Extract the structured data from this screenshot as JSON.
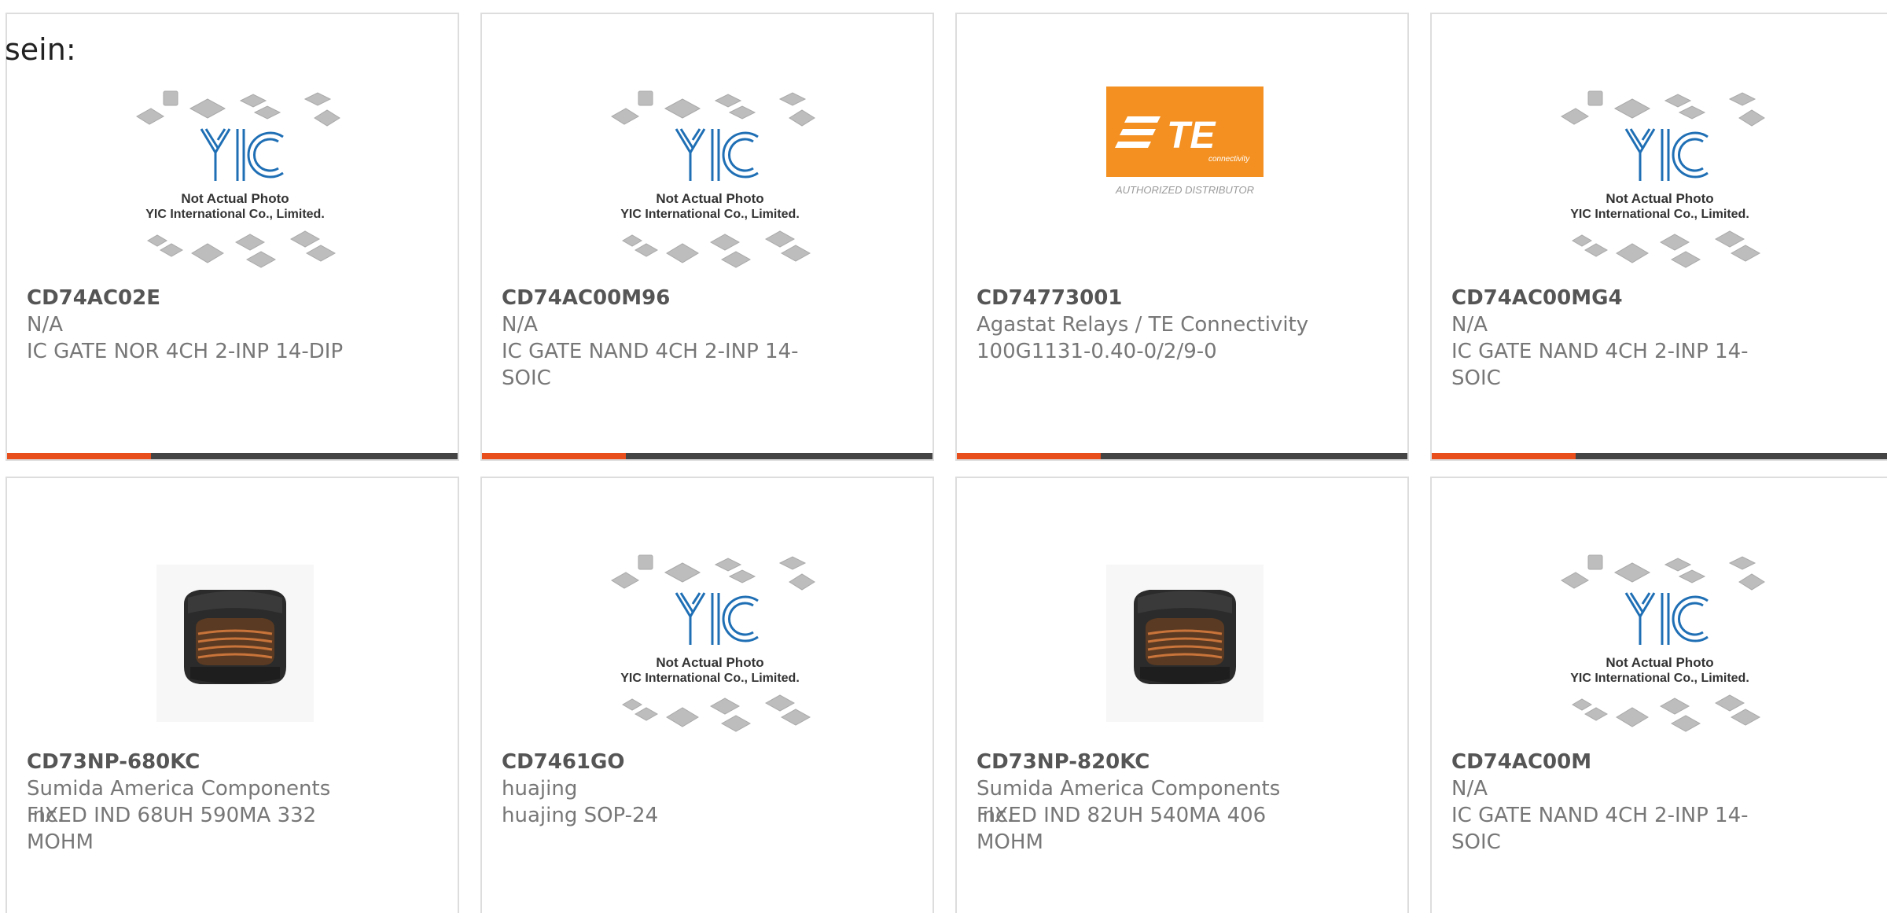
{
  "lead_text": "sein:",
  "colors": {
    "accent": "#e84d1c",
    "bar": "#444444",
    "border": "#dddddd"
  },
  "placeholder": {
    "caption_line1": "Not Actual Photo",
    "caption_line2": "YIC International Co., Limited."
  },
  "te_logo": {
    "brand": "TE",
    "sub": "connectivity",
    "tagline": "AUTHORIZED DISTRIBUTOR"
  },
  "products": [
    {
      "part": "CD74AC02E",
      "maker": "N/A",
      "desc": "IC GATE NOR 4CH 2-INP 14-DIP",
      "image": "yic-placeholder"
    },
    {
      "part": "CD74AC00M96",
      "maker": "N/A",
      "desc": "IC GATE NAND 4CH 2-INP 14-SOIC",
      "image": "yic-placeholder"
    },
    {
      "part": "CD74773001",
      "maker": "Agastat Relays / TE Connectivity",
      "desc": "100G1131-0.40-0/2/9-0",
      "image": "te-logo"
    },
    {
      "part": "CD74AC00MG4",
      "maker": "N/A",
      "desc": "IC GATE NAND 4CH 2-INP 14-SOIC",
      "image": "yic-placeholder"
    },
    {
      "part": "CD73NP-680KC",
      "maker": "Sumida America Components Inc.",
      "desc": "FIXED IND 68UH 590MA 332 MOHM",
      "image": "inductor"
    },
    {
      "part": "CD7461GO",
      "maker": "huajing",
      "desc": "huajing SOP-24",
      "image": "yic-placeholder"
    },
    {
      "part": "CD73NP-820KC",
      "maker": "Sumida America Components Inc.",
      "desc": "FIXED IND 82UH 540MA 406 MOHM",
      "image": "inductor"
    },
    {
      "part": "CD74AC00M",
      "maker": "N/A",
      "desc": "IC GATE NAND 4CH 2-INP 14-SOIC",
      "image": "yic-placeholder"
    }
  ]
}
